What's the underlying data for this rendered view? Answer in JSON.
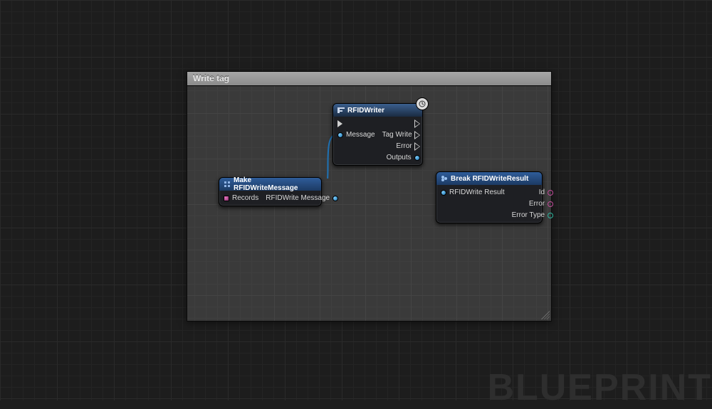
{
  "watermark": "BLUEPRINT",
  "panel": {
    "title": "Write tag"
  },
  "nodes": {
    "make": {
      "title": "Make RFIDWriteMessage",
      "inputs": [
        {
          "name": "records",
          "label": "Records",
          "type": "array-magenta"
        }
      ],
      "outputs": [
        {
          "name": "rfid-message",
          "label": "RFIDWrite Message",
          "type": "blue"
        }
      ]
    },
    "writer": {
      "title": "RFIDWriter",
      "latent": true,
      "inputs": [
        {
          "name": "exec-in",
          "label": "",
          "type": "exec"
        },
        {
          "name": "message",
          "label": "Message",
          "type": "blue"
        }
      ],
      "outputs": [
        {
          "name": "exec-out",
          "label": "",
          "type": "exec-hollow"
        },
        {
          "name": "tag-write",
          "label": "Tag Write",
          "type": "exec-hollow"
        },
        {
          "name": "error",
          "label": "Error",
          "type": "exec-hollow"
        },
        {
          "name": "outputs",
          "label": "Outputs",
          "type": "blue"
        }
      ]
    },
    "break": {
      "title": "Break RFIDWriteResult",
      "inputs": [
        {
          "name": "result",
          "label": "RFIDWrite Result",
          "type": "blue"
        }
      ],
      "outputs": [
        {
          "name": "id",
          "label": "Id",
          "type": "magenta-hollow"
        },
        {
          "name": "error",
          "label": "Error",
          "type": "magenta-hollow"
        },
        {
          "name": "error-type",
          "label": "Error Type",
          "type": "cyan-hollow"
        }
      ]
    }
  }
}
